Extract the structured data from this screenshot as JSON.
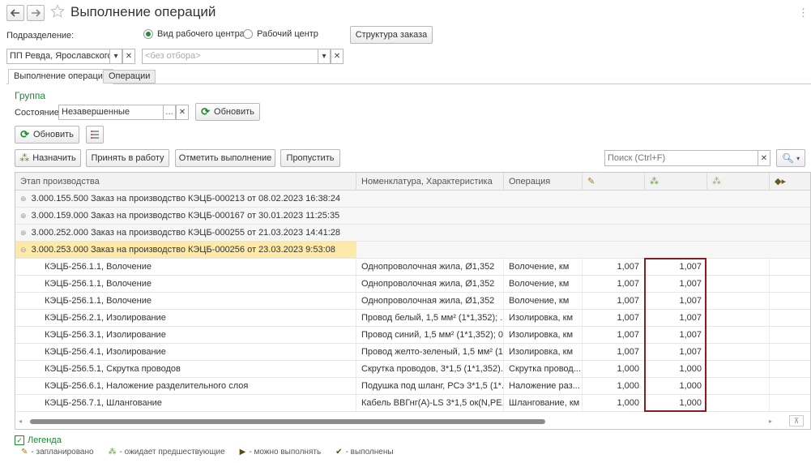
{
  "window": {
    "title": "Выполнение операций"
  },
  "filters": {
    "subdivision_label": "Подразделение:",
    "radio_work_center_type": "Вид рабочего центра",
    "radio_work_center": "Рабочий центр",
    "order_structure_button": "Структура заказа",
    "subdivision_value": "ПП Ревда, Ярославского",
    "work_center_placeholder": "<без отбора>"
  },
  "tabs": [
    {
      "label": "Выполнение операций"
    },
    {
      "label": "Операции"
    }
  ],
  "group": {
    "title": "Группа",
    "state_label": "Состояние:",
    "state_value": "Незавершенные",
    "refresh_label": "Обновить"
  },
  "toolbar": {
    "refresh_label": "Обновить",
    "assign_label": "Назначить",
    "accept_label": "Принять в работу",
    "mark_done_label": "Отметить выполнение",
    "skip_label": "Пропустить",
    "search_placeholder": "Поиск (Ctrl+F)"
  },
  "table": {
    "headers": [
      "Этап производства",
      "Номенклатура, Характеристика",
      "Операция"
    ],
    "groups": [
      {
        "label": "3.000.155.500 Заказ на производство КЭЦБ-000213 от 08.02.2023 16:38:24"
      },
      {
        "label": "3.000.159.000 Заказ на производство КЭЦБ-000167 от 30.01.2023 11:25:35"
      },
      {
        "label": "3.000.252.000 Заказ на производство КЭЦБ-000255 от 21.03.2023 14:41:28"
      },
      {
        "label": "3.000.253.000 Заказ на производство КЭЦБ-000256 от 23.03.2023 9:53:08"
      }
    ],
    "rows": [
      {
        "stage": "КЭЦБ-256.1.1, Волочение",
        "item": "Однопроволочная жила, Ø1,352",
        "operation": "Волочение, км",
        "planned": "1,007",
        "waiting": "1,007"
      },
      {
        "stage": "КЭЦБ-256.1.1, Волочение",
        "item": "Однопроволочная жила, Ø1,352",
        "operation": "Волочение, км",
        "planned": "1,007",
        "waiting": "1,007"
      },
      {
        "stage": "КЭЦБ-256.1.1, Волочение",
        "item": "Однопроволочная жила, Ø1,352",
        "operation": "Волочение, км",
        "planned": "1,007",
        "waiting": "1,007"
      },
      {
        "stage": "КЭЦБ-256.2.1, Изолирование",
        "item": "Провод белый, 1,5 мм² (1*1,352); ...",
        "operation": "Изолировка, км",
        "planned": "1,007",
        "waiting": "1,007"
      },
      {
        "stage": "КЭЦБ-256.3.1, Изолирование",
        "item": "Провод синий, 1,5 мм² (1*1,352); 0...",
        "operation": "Изолировка, км",
        "planned": "1,007",
        "waiting": "1,007"
      },
      {
        "stage": "КЭЦБ-256.4.1, Изолирование",
        "item": "Провод желто-зеленый, 1,5 мм² (1...",
        "operation": "Изолировка, км",
        "planned": "1,007",
        "waiting": "1,007"
      },
      {
        "stage": "КЭЦБ-256.5.1, Скрутка проводов",
        "item": "Скрутка проводов, 3*1,5 (1*1,352)...",
        "operation": "Скрутка провод...",
        "planned": "1,000",
        "waiting": "1,000"
      },
      {
        "stage": "КЭЦБ-256.6.1, Наложение разделительного слоя",
        "item": "Подушка под шланг, РСэ 3*1,5 (1*...",
        "operation": "Наложение раз...",
        "planned": "1,000",
        "waiting": "1,000"
      },
      {
        "stage": "КЭЦБ-256.7.1, Шлангование",
        "item": "Кабель ВВГнг(А)-LS 3*1,5 ок(N,PE...",
        "operation": "Шлангование, км",
        "planned": "1,000",
        "waiting": "1,000"
      }
    ]
  },
  "legend": {
    "title": "Легенда",
    "planned": "- запланировано",
    "waiting": "- ожидает предшествующие",
    "can_do": "- можно выполнять",
    "done": "- выполнены"
  },
  "colors": {
    "accent_green": "#1b8a36",
    "selected_group": "#fde9a8",
    "highlight_box": "#8a1c24"
  }
}
